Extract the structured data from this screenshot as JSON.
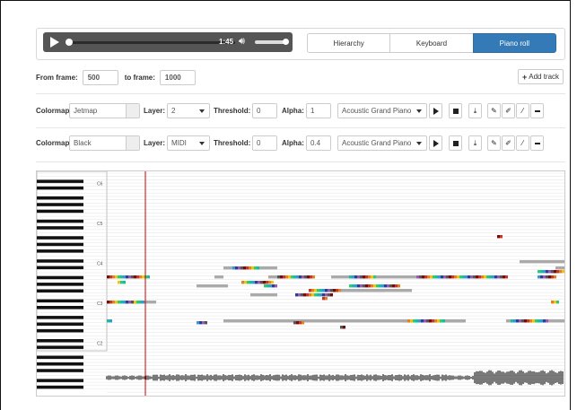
{
  "player": {
    "time": "1:45",
    "progress": 0.0
  },
  "tabs": [
    {
      "label": "Hierarchy",
      "active": false
    },
    {
      "label": "Keyboard",
      "active": false
    },
    {
      "label": "Piano roll",
      "active": true
    }
  ],
  "frames": {
    "from_label": "From frame:",
    "from_value": "500",
    "to_label": "to frame:",
    "to_value": "1000"
  },
  "add_track": {
    "label": "Add track",
    "icon": "plus-icon"
  },
  "tracks": [
    {
      "colormap_label": "Colormap:",
      "colormap": "Jetmap",
      "layer_label": "Layer:",
      "layer": "2",
      "threshold_label": "Threshold:",
      "threshold": "0",
      "alpha_label": "Alpha:",
      "alpha": "1",
      "instrument": "Acoustic Grand Piano"
    },
    {
      "colormap_label": "Colormap:",
      "colormap": "Black",
      "layer_label": "Layer:",
      "layer": "MIDI",
      "threshold_label": "Threshold:",
      "threshold": "0",
      "alpha_label": "Alpha:",
      "alpha": "0.4",
      "instrument": "Acoustic Grand Piano"
    }
  ],
  "piano_roll": {
    "octave_labels": [
      "C6",
      "C5",
      "C4",
      "C3",
      "C2"
    ],
    "playhead_color": "#cc0000"
  },
  "colors": {
    "accent": "#337ab7",
    "player_bg": "#555555"
  }
}
